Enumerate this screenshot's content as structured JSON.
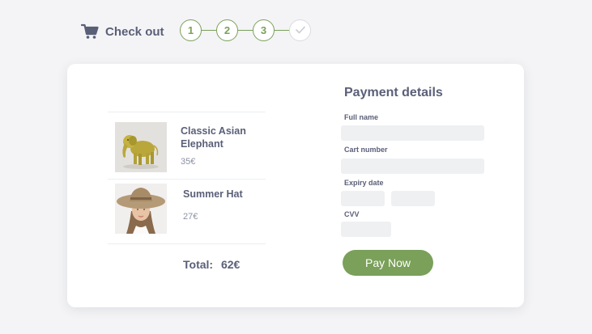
{
  "header": {
    "title": "Check out",
    "icon": "cart-icon",
    "steps": [
      "1",
      "2",
      "3"
    ],
    "final_step_icon": "checkmark-icon"
  },
  "colors": {
    "accent": "#7aa05a",
    "text": "#5a5f78",
    "field_bg": "#eff0f2",
    "card_bg": "#ffffff",
    "page_bg": "#f4f4f6"
  },
  "cart": {
    "items": [
      {
        "name": "Classic Asian Elephant",
        "price": "35€"
      },
      {
        "name": "Summer Hat",
        "price": "27€"
      }
    ],
    "total_label": "Total:",
    "total_value": "62€"
  },
  "payment": {
    "title": "Payment details",
    "full_name_label": "Full name",
    "card_number_label": "Cart number",
    "expiry_label": "Expiry date",
    "cvv_label": "CVV",
    "pay_button": "Pay Now"
  }
}
